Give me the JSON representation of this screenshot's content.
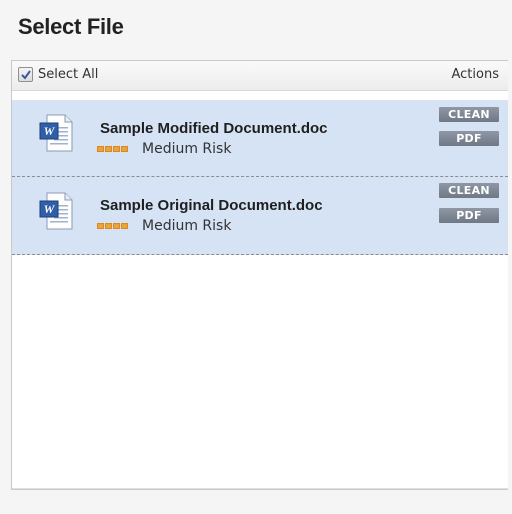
{
  "title": "Select File",
  "header": {
    "select_all_label": "Select All",
    "select_all_checked": true,
    "actions_label": "Actions"
  },
  "files": [
    {
      "name": "Sample Modified Document.doc",
      "icon": "word-document-icon",
      "risk_label": "Medium Risk",
      "actions": {
        "clean": "CLEAN",
        "pdf": "PDF"
      }
    },
    {
      "name": "Sample Original Document.doc",
      "icon": "word-document-icon",
      "risk_label": "Medium Risk",
      "actions": {
        "clean": "CLEAN",
        "pdf": "PDF"
      }
    }
  ],
  "colors": {
    "row_background": "#d5e3f5",
    "risk_bar": "#f0a23a",
    "action_button": "#7b8390"
  }
}
